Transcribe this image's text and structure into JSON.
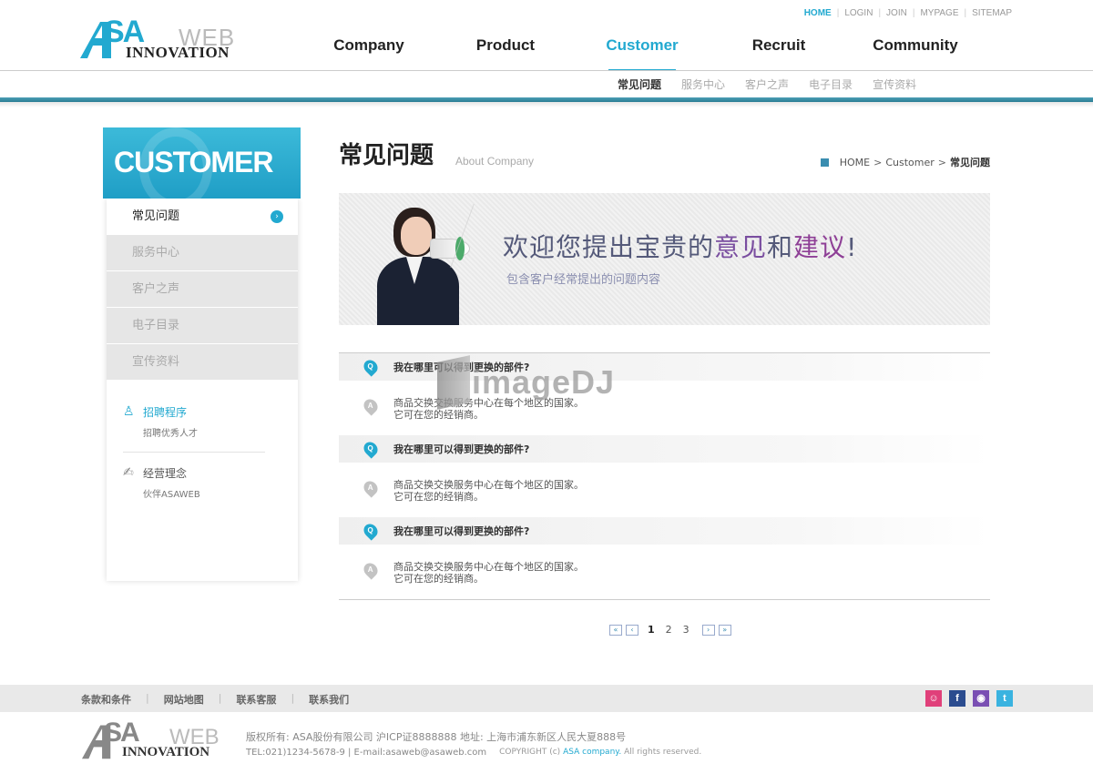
{
  "header": {
    "logo": {
      "sa": "SA",
      "web": "WEB",
      "innovation": "INNOVATION"
    },
    "util_links": [
      {
        "label": "HOME",
        "active": true
      },
      {
        "label": "LOGIN"
      },
      {
        "label": "JOIN"
      },
      {
        "label": "MYPAGE"
      },
      {
        "label": "SITEMAP"
      }
    ],
    "nav": [
      "Company",
      "Product",
      "Customer",
      "Recruit",
      "Community"
    ],
    "subnav": [
      "常见问题",
      "服务中心",
      "客户之声",
      "电子目录",
      "宣传资料"
    ]
  },
  "sidebar": {
    "title": "CUSTOMER",
    "items": [
      "常见问题",
      "服务中心",
      "客户之声",
      "电子目录",
      "宣传资料"
    ],
    "extras": [
      {
        "title": "招聘程序",
        "sub": "招聘优秀人才",
        "icon": "person-icon"
      },
      {
        "title": "经营理念",
        "sub": "伙伴ASAWEB",
        "icon": "handshake-icon"
      }
    ]
  },
  "content": {
    "title": "常见问题",
    "subtitle": "About Company",
    "breadcrumb": {
      "home": "HOME",
      "section": "Customer",
      "current": "常见问题"
    },
    "banner": {
      "headline_a": "欢迎您提出宝贵的",
      "headline_b": "意见",
      "headline_c": "和",
      "headline_d": "建议",
      "headline_e": "!",
      "subline": "包含客户经常提出的问题内容"
    },
    "faq": [
      {
        "q": "我在哪里可以得到更换的部件?",
        "a1": "商品交换交换服务中心在每个地区的国家。",
        "a2": "它可在您的经销商。"
      },
      {
        "q": "我在哪里可以得到更换的部件?",
        "a1": "商品交换交换服务中心在每个地区的国家。",
        "a2": "它可在您的经销商。"
      },
      {
        "q": "我在哪里可以得到更换的部件?",
        "a1": "商品交换交换服务中心在每个地区的国家。",
        "a2": "它可在您的经销商。"
      }
    ],
    "badge_q": "Q",
    "badge_a": "A",
    "pager": {
      "first": "«",
      "prev": "‹",
      "pages": [
        "1",
        "2",
        "3"
      ],
      "current": "1",
      "next": "›",
      "last": "»"
    }
  },
  "watermark": {
    "text": "imageDJ"
  },
  "footer": {
    "links": [
      "条款和条件",
      "网站地图",
      "联系客服",
      "联系我们"
    ],
    "social": [
      {
        "name": "me2day-icon",
        "glyph": "☺",
        "color": "#e0407a"
      },
      {
        "name": "facebook-icon",
        "glyph": "f",
        "color": "#2b4c8f"
      },
      {
        "name": "yozm-icon",
        "glyph": "◉",
        "color": "#7a4fb3"
      },
      {
        "name": "twitter-icon",
        "glyph": "t",
        "color": "#3ab3e0"
      }
    ],
    "logo": {
      "sa": "SA",
      "web": "WEB",
      "innovation": "INNOVATION"
    },
    "line1": "版权所有: ASA股份有限公司 沪ICP证8888888 地址: 上海市浦东新区人民大夏888号",
    "line2": "TEL:021)1234-5678-9 | E-mail:asaweb@asaweb.com",
    "copyright_a": "COPYRIGHT (c)",
    "copyright_brand": "ASA company.",
    "copyright_b": "All rights reserved."
  }
}
